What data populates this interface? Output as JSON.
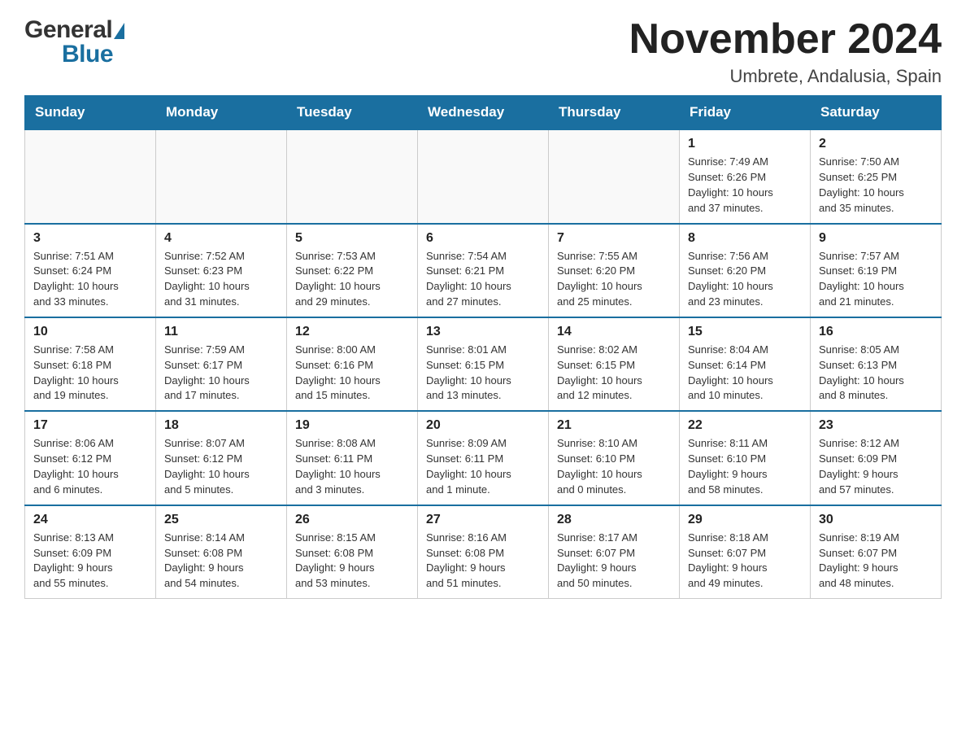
{
  "header": {
    "title": "November 2024",
    "subtitle": "Umbrete, Andalusia, Spain",
    "logo_general": "General",
    "logo_blue": "Blue"
  },
  "weekdays": [
    "Sunday",
    "Monday",
    "Tuesday",
    "Wednesday",
    "Thursday",
    "Friday",
    "Saturday"
  ],
  "weeks": [
    [
      {
        "day": "",
        "info": ""
      },
      {
        "day": "",
        "info": ""
      },
      {
        "day": "",
        "info": ""
      },
      {
        "day": "",
        "info": ""
      },
      {
        "day": "",
        "info": ""
      },
      {
        "day": "1",
        "info": "Sunrise: 7:49 AM\nSunset: 6:26 PM\nDaylight: 10 hours\nand 37 minutes."
      },
      {
        "day": "2",
        "info": "Sunrise: 7:50 AM\nSunset: 6:25 PM\nDaylight: 10 hours\nand 35 minutes."
      }
    ],
    [
      {
        "day": "3",
        "info": "Sunrise: 7:51 AM\nSunset: 6:24 PM\nDaylight: 10 hours\nand 33 minutes."
      },
      {
        "day": "4",
        "info": "Sunrise: 7:52 AM\nSunset: 6:23 PM\nDaylight: 10 hours\nand 31 minutes."
      },
      {
        "day": "5",
        "info": "Sunrise: 7:53 AM\nSunset: 6:22 PM\nDaylight: 10 hours\nand 29 minutes."
      },
      {
        "day": "6",
        "info": "Sunrise: 7:54 AM\nSunset: 6:21 PM\nDaylight: 10 hours\nand 27 minutes."
      },
      {
        "day": "7",
        "info": "Sunrise: 7:55 AM\nSunset: 6:20 PM\nDaylight: 10 hours\nand 25 minutes."
      },
      {
        "day": "8",
        "info": "Sunrise: 7:56 AM\nSunset: 6:20 PM\nDaylight: 10 hours\nand 23 minutes."
      },
      {
        "day": "9",
        "info": "Sunrise: 7:57 AM\nSunset: 6:19 PM\nDaylight: 10 hours\nand 21 minutes."
      }
    ],
    [
      {
        "day": "10",
        "info": "Sunrise: 7:58 AM\nSunset: 6:18 PM\nDaylight: 10 hours\nand 19 minutes."
      },
      {
        "day": "11",
        "info": "Sunrise: 7:59 AM\nSunset: 6:17 PM\nDaylight: 10 hours\nand 17 minutes."
      },
      {
        "day": "12",
        "info": "Sunrise: 8:00 AM\nSunset: 6:16 PM\nDaylight: 10 hours\nand 15 minutes."
      },
      {
        "day": "13",
        "info": "Sunrise: 8:01 AM\nSunset: 6:15 PM\nDaylight: 10 hours\nand 13 minutes."
      },
      {
        "day": "14",
        "info": "Sunrise: 8:02 AM\nSunset: 6:15 PM\nDaylight: 10 hours\nand 12 minutes."
      },
      {
        "day": "15",
        "info": "Sunrise: 8:04 AM\nSunset: 6:14 PM\nDaylight: 10 hours\nand 10 minutes."
      },
      {
        "day": "16",
        "info": "Sunrise: 8:05 AM\nSunset: 6:13 PM\nDaylight: 10 hours\nand 8 minutes."
      }
    ],
    [
      {
        "day": "17",
        "info": "Sunrise: 8:06 AM\nSunset: 6:12 PM\nDaylight: 10 hours\nand 6 minutes."
      },
      {
        "day": "18",
        "info": "Sunrise: 8:07 AM\nSunset: 6:12 PM\nDaylight: 10 hours\nand 5 minutes."
      },
      {
        "day": "19",
        "info": "Sunrise: 8:08 AM\nSunset: 6:11 PM\nDaylight: 10 hours\nand 3 minutes."
      },
      {
        "day": "20",
        "info": "Sunrise: 8:09 AM\nSunset: 6:11 PM\nDaylight: 10 hours\nand 1 minute."
      },
      {
        "day": "21",
        "info": "Sunrise: 8:10 AM\nSunset: 6:10 PM\nDaylight: 10 hours\nand 0 minutes."
      },
      {
        "day": "22",
        "info": "Sunrise: 8:11 AM\nSunset: 6:10 PM\nDaylight: 9 hours\nand 58 minutes."
      },
      {
        "day": "23",
        "info": "Sunrise: 8:12 AM\nSunset: 6:09 PM\nDaylight: 9 hours\nand 57 minutes."
      }
    ],
    [
      {
        "day": "24",
        "info": "Sunrise: 8:13 AM\nSunset: 6:09 PM\nDaylight: 9 hours\nand 55 minutes."
      },
      {
        "day": "25",
        "info": "Sunrise: 8:14 AM\nSunset: 6:08 PM\nDaylight: 9 hours\nand 54 minutes."
      },
      {
        "day": "26",
        "info": "Sunrise: 8:15 AM\nSunset: 6:08 PM\nDaylight: 9 hours\nand 53 minutes."
      },
      {
        "day": "27",
        "info": "Sunrise: 8:16 AM\nSunset: 6:08 PM\nDaylight: 9 hours\nand 51 minutes."
      },
      {
        "day": "28",
        "info": "Sunrise: 8:17 AM\nSunset: 6:07 PM\nDaylight: 9 hours\nand 50 minutes."
      },
      {
        "day": "29",
        "info": "Sunrise: 8:18 AM\nSunset: 6:07 PM\nDaylight: 9 hours\nand 49 minutes."
      },
      {
        "day": "30",
        "info": "Sunrise: 8:19 AM\nSunset: 6:07 PM\nDaylight: 9 hours\nand 48 minutes."
      }
    ]
  ]
}
